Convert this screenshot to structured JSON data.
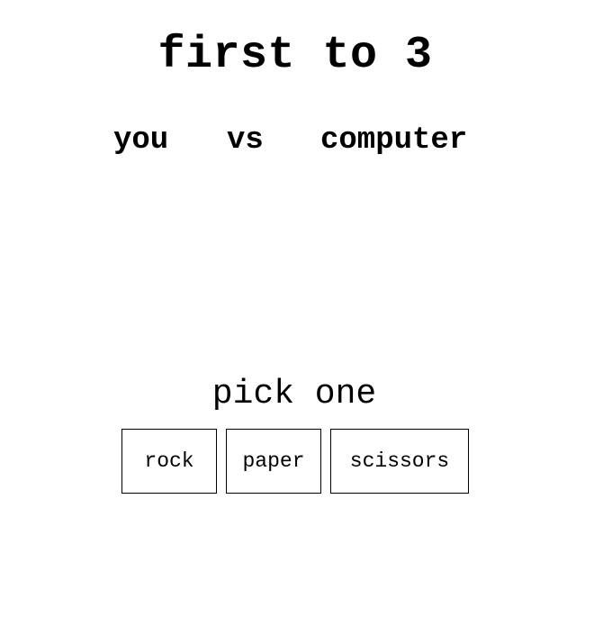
{
  "header": {
    "title": "first to 3"
  },
  "scoreboard": {
    "player_label": "you",
    "versus_label": "vs",
    "opponent_label": "computer"
  },
  "prompt": {
    "text": "pick one"
  },
  "choices": [
    {
      "label": "rock"
    },
    {
      "label": "paper"
    },
    {
      "label": "scissors"
    }
  ]
}
